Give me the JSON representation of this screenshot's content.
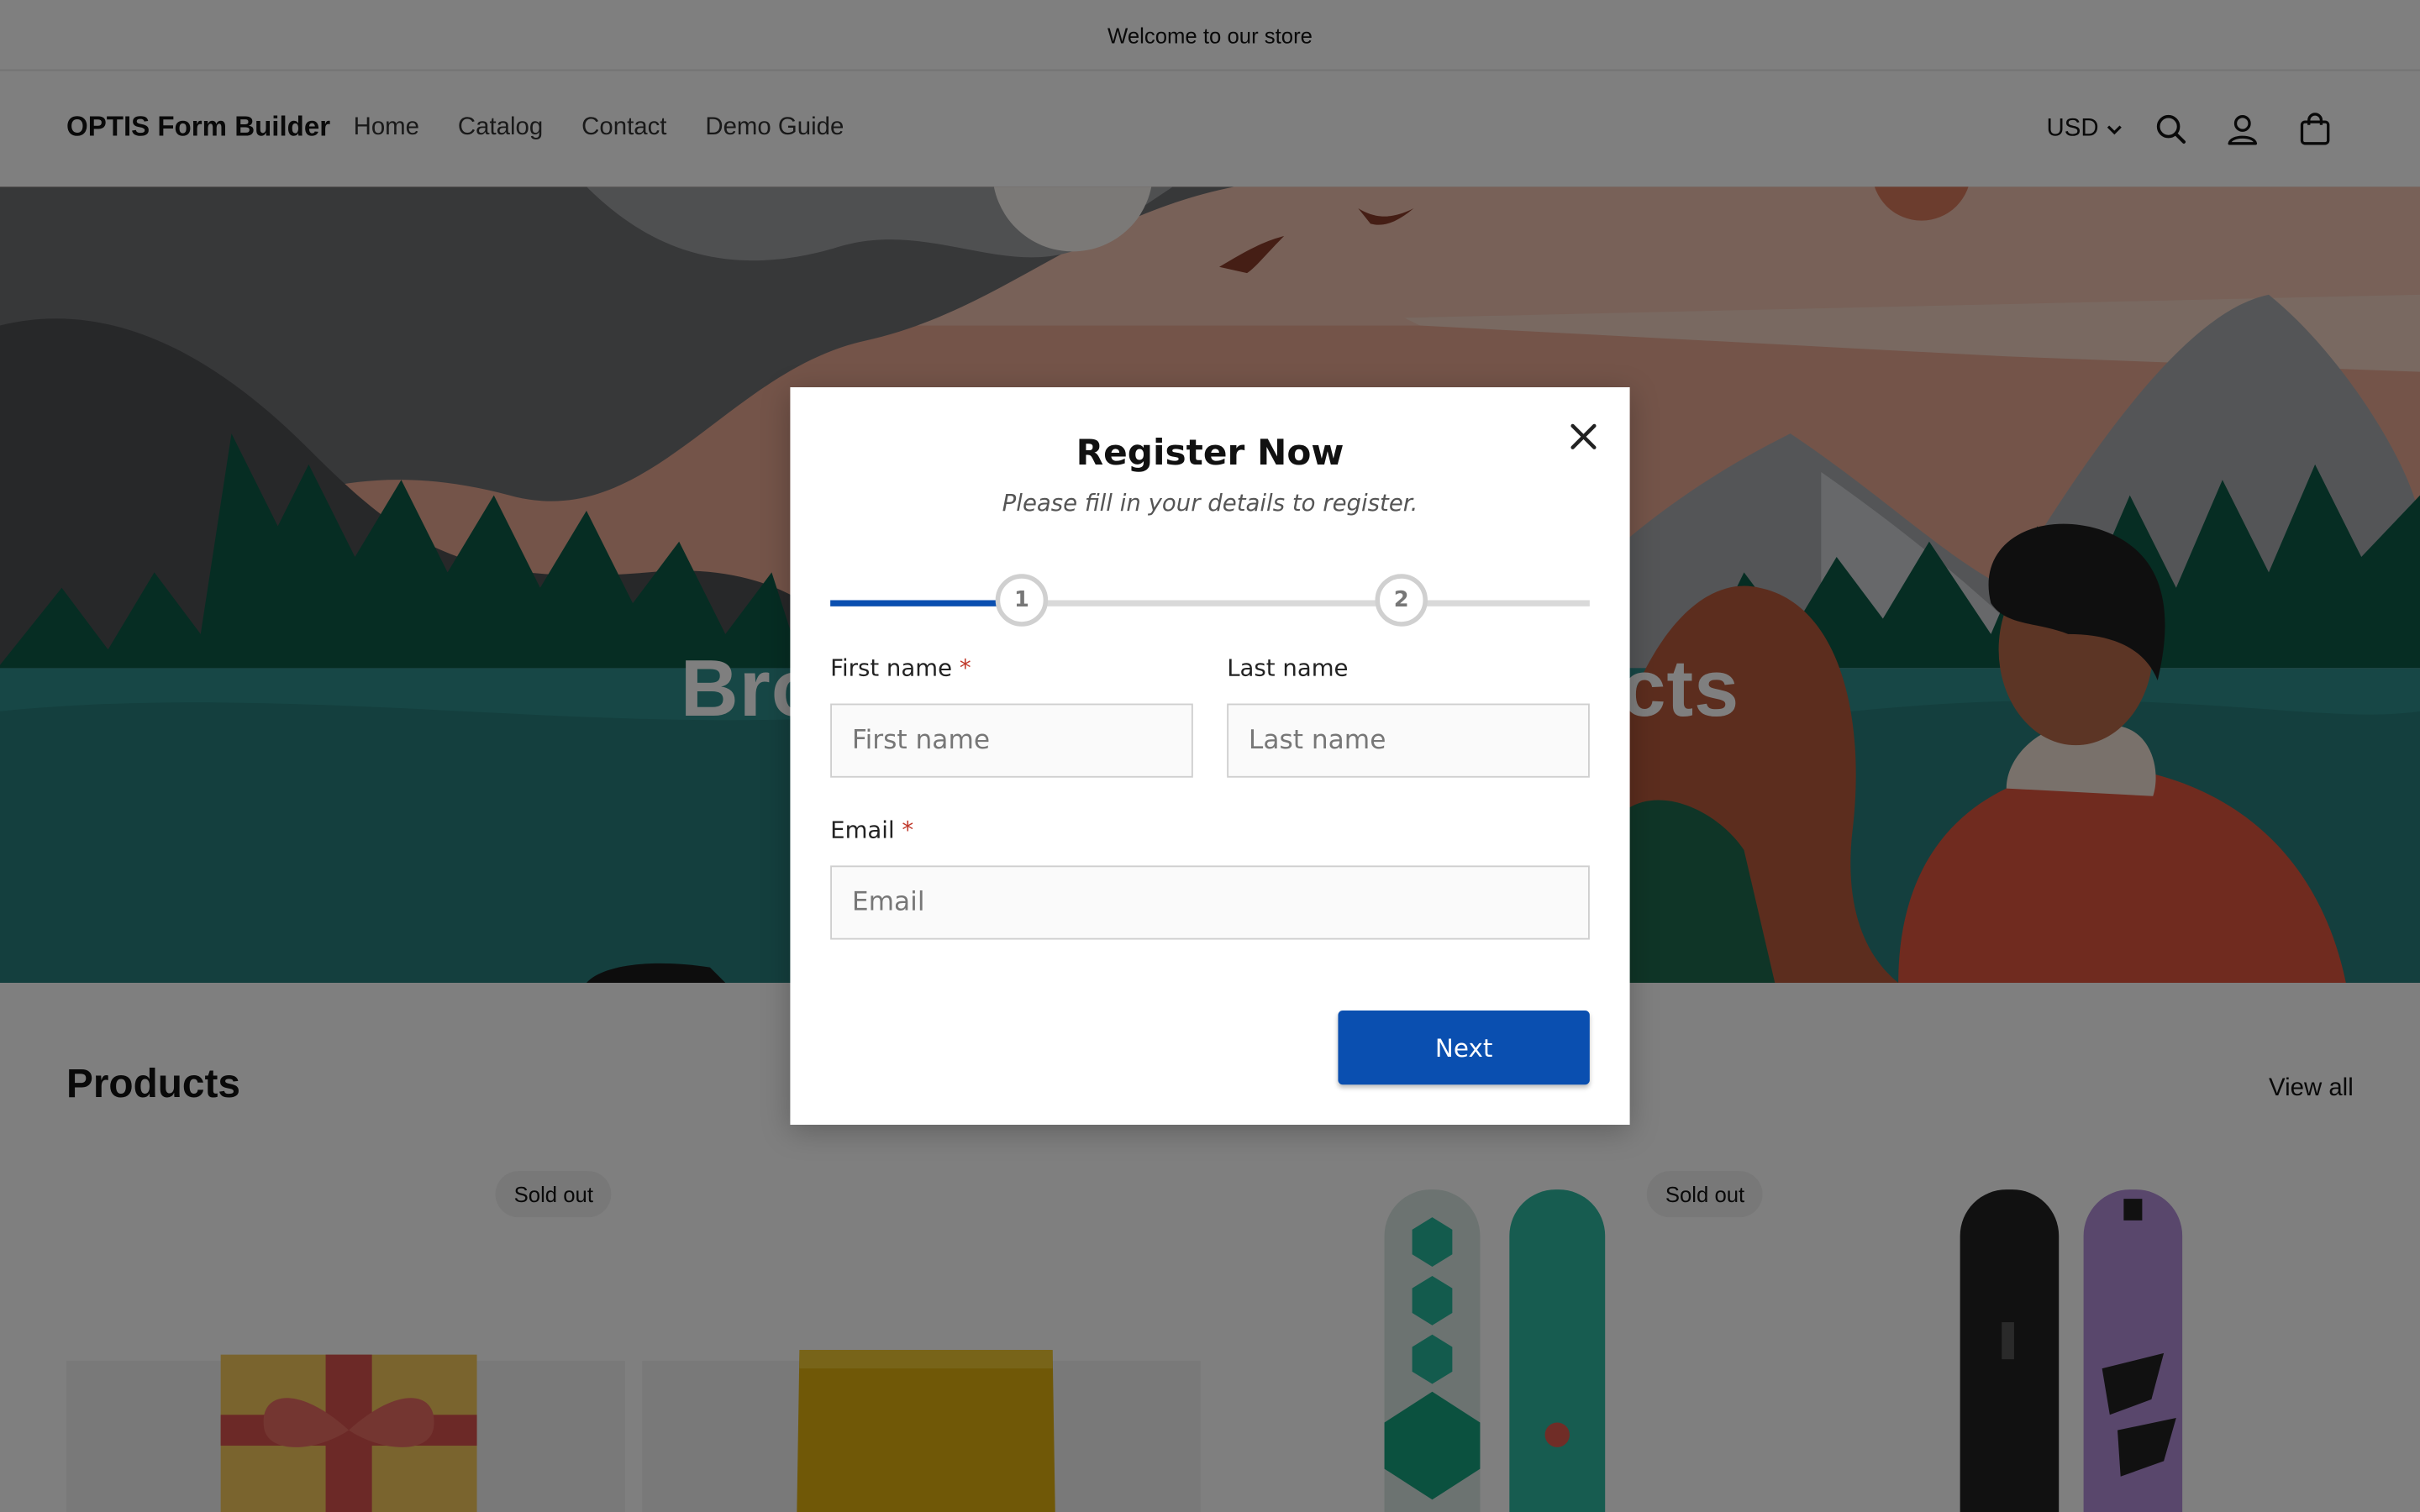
{
  "announcement": "Welcome to our store",
  "header": {
    "logo": "OPTIS Form Builder",
    "nav": [
      "Home",
      "Catalog",
      "Contact",
      "Demo Guide"
    ],
    "currency": "USD",
    "icons": [
      "search-icon",
      "account-icon",
      "cart-icon"
    ]
  },
  "hero": {
    "title": "Browse our latest products"
  },
  "products": {
    "title": "Products",
    "view_all": "View all",
    "badges": [
      "Sold out",
      "Sold out"
    ]
  },
  "modal": {
    "title": "Register Now",
    "subtitle": "Please fill in your details to register.",
    "steps": [
      "1",
      "2"
    ],
    "progress": 0.22,
    "first_name_label": "First name",
    "first_name_placeholder": "First name",
    "last_name_label": "Last name",
    "last_name_placeholder": "Last name",
    "email_label": "Email",
    "email_placeholder": "Email",
    "required_mark": "*",
    "next_label": "Next"
  },
  "colors": {
    "primary": "#0a4fb0",
    "required": "#c0392b"
  }
}
